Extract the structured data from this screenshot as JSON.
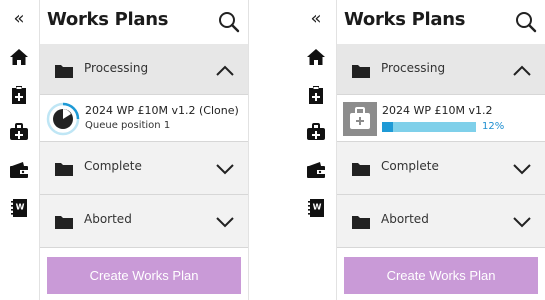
{
  "colors": {
    "accent_button": "#c99ad7",
    "progress_fill": "#1e9ad6",
    "progress_track": "#7fd0ea",
    "header_bg": "#e7e7e7"
  },
  "left": {
    "rail": {
      "collapse_icon": "«",
      "icons": [
        "home-icon",
        "clipboard-add-icon",
        "medical-kit-icon",
        "wallet-icon",
        "workbook-icon"
      ]
    },
    "title": "Works Plans",
    "sections": {
      "processing": "Processing",
      "complete": "Complete",
      "aborted": "Aborted"
    },
    "item": {
      "name": "2024 WP £10M v1.2 (Clone)",
      "status": "Queue position 1"
    },
    "create_button": "Create Works Plan"
  },
  "right": {
    "rail": {
      "collapse_icon": "«",
      "icons": [
        "home-icon",
        "clipboard-add-icon",
        "medical-kit-icon",
        "wallet-icon",
        "workbook-icon"
      ]
    },
    "title": "Works Plans",
    "sections": {
      "processing": "Processing",
      "complete": "Complete",
      "aborted": "Aborted"
    },
    "item": {
      "name": "2024 WP £10M v1.2",
      "progress_percent": 12,
      "progress_label": "12%"
    },
    "create_button": "Create Works Plan"
  }
}
